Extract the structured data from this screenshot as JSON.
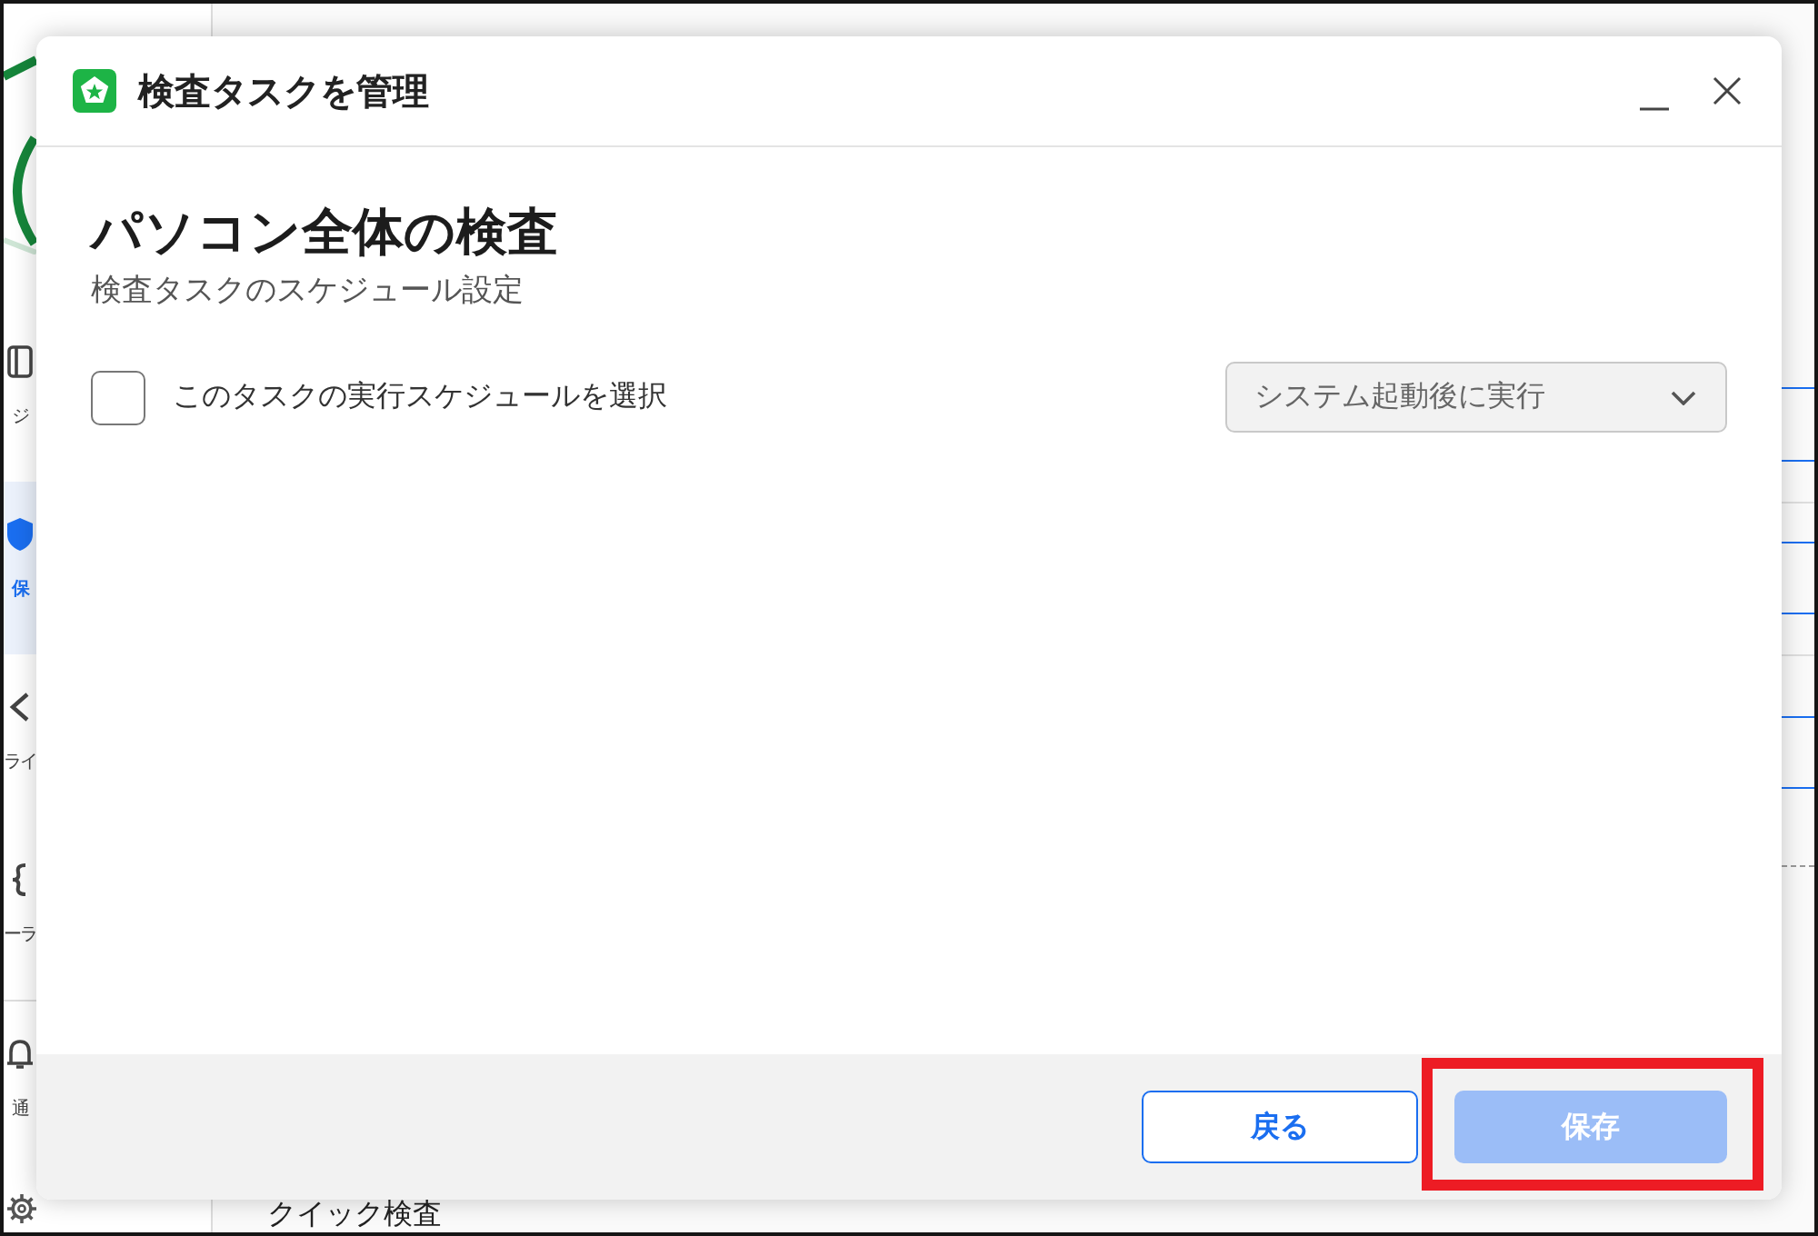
{
  "app": {
    "sidebar": {
      "items": [
        {
          "label": "ジ",
          "selected": false
        },
        {
          "label": "保",
          "selected": true
        },
        {
          "label": "ライ",
          "selected": false
        },
        {
          "label": "ーラ",
          "selected": false
        },
        {
          "label": "通",
          "selected": false
        }
      ]
    },
    "list": {
      "row_label": "クイック検査"
    }
  },
  "dialog": {
    "title": "検査タスクを管理",
    "heading": "パソコン全体の検査",
    "subtitle": "検査タスクのスケジュール設定",
    "schedule": {
      "label": "このタスクの実行スケジュールを選択",
      "checked": false,
      "dropdown": {
        "value": "システム起動後に実行",
        "disabled": true
      }
    },
    "buttons": [
      {
        "kind": "secondary",
        "label": "戻る",
        "disabled": false,
        "highlighted": false
      },
      {
        "kind": "primary",
        "label": "保存",
        "disabled": true,
        "highlighted": true
      }
    ]
  }
}
